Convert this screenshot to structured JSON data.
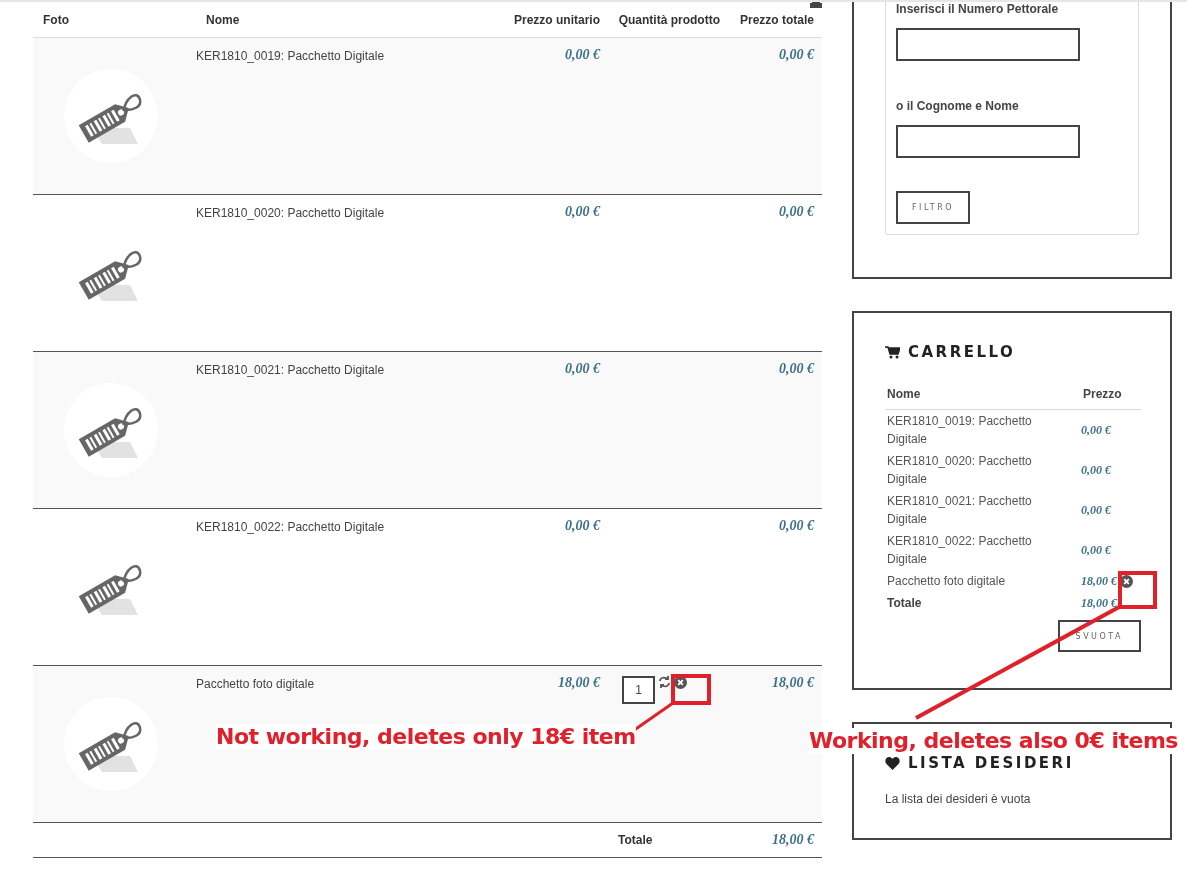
{
  "table": {
    "columns": [
      "Foto",
      "Nome",
      "Prezzo unitario",
      "Quantità prodotto",
      "Prezzo totale"
    ],
    "rows": [
      {
        "name": "KER1810_0019: Pacchetto Digitale",
        "unit_price": "0,00 €",
        "total": "0,00 €"
      },
      {
        "name": "KER1810_0020: Pacchetto Digitale",
        "unit_price": "0,00 €",
        "total": "0,00 €"
      },
      {
        "name": "KER1810_0021: Pacchetto Digitale",
        "unit_price": "0,00 €",
        "total": "0,00 €"
      },
      {
        "name": "KER1810_0022: Pacchetto Digitale",
        "unit_price": "0,00 €",
        "total": "0,00 €"
      },
      {
        "name": "Pacchetto foto digitale",
        "unit_price": "18,00 €",
        "total": "18,00 €",
        "quantity": "1"
      }
    ],
    "total_label": "Totale",
    "total_value": "18,00 €"
  },
  "filter": {
    "fields": [
      {
        "label": "Inserisci il Numero Pettorale"
      },
      {
        "label": "o il Cognome e Nome"
      }
    ],
    "button": "FILTRO"
  },
  "cart": {
    "title": "CARRELLO",
    "columns": [
      "Nome",
      "Prezzo"
    ],
    "items": [
      {
        "name": "KER1810_0019: Pacchetto Digitale",
        "price": "0,00 €",
        "removable": false
      },
      {
        "name": "KER1810_0020: Pacchetto Digitale",
        "price": "0,00 €",
        "removable": false
      },
      {
        "name": "KER1810_0021: Pacchetto Digitale",
        "price": "0,00 €",
        "removable": false
      },
      {
        "name": "KER1810_0022: Pacchetto Digitale",
        "price": "0,00 €",
        "removable": false
      },
      {
        "name": "Pacchetto foto digitale",
        "price": "18,00 €",
        "removable": true
      }
    ],
    "total_label": "Totale",
    "total_value": "18,00 €",
    "button": "SVUOTA"
  },
  "wishlist": {
    "title": "LISTA DESIDERI",
    "empty_text": "La lista dei desideri è vuota"
  },
  "annotations": [
    {
      "text": "Not working, deletes only 18€ item"
    },
    {
      "text": "Working, deletes also 0€ items"
    }
  ]
}
